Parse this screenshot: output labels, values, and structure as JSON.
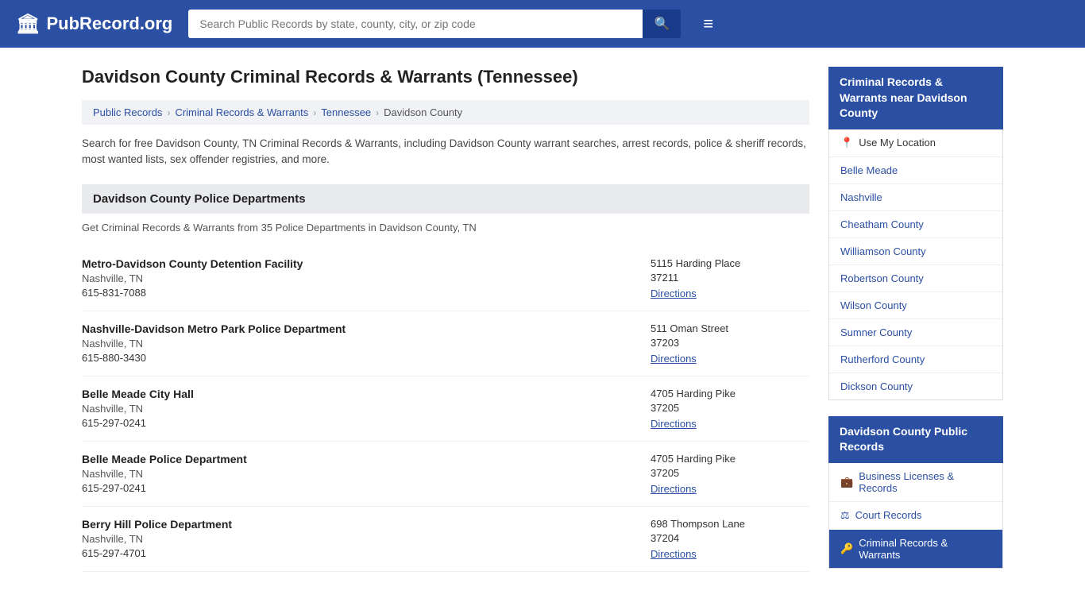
{
  "header": {
    "logo_text": "PubRecord.org",
    "logo_icon": "🏛",
    "search_placeholder": "Search Public Records by state, county, city, or zip code",
    "search_icon": "🔍",
    "menu_icon": "≡"
  },
  "page": {
    "title": "Davidson County Criminal Records & Warrants (Tennessee)",
    "breadcrumbs": [
      {
        "label": "Public Records",
        "href": "#"
      },
      {
        "label": "Criminal Records & Warrants",
        "href": "#"
      },
      {
        "label": "Tennessee",
        "href": "#"
      },
      {
        "label": "Davidson County",
        "href": "#"
      }
    ],
    "description": "Search for free Davidson County, TN Criminal Records & Warrants, including Davidson County warrant searches, arrest records, police & sheriff records, most wanted lists, sex offender registries, and more.",
    "section_title": "Davidson County Police Departments",
    "section_subtitle": "Get Criminal Records & Warrants from 35 Police Departments in Davidson County, TN",
    "entries": [
      {
        "name": "Metro-Davidson County Detention Facility",
        "city": "Nashville, TN",
        "phone": "615-831-7088",
        "address": "5115 Harding Place",
        "zip": "37211",
        "directions": "Directions"
      },
      {
        "name": "Nashville-Davidson Metro Park Police Department",
        "city": "Nashville, TN",
        "phone": "615-880-3430",
        "address": "511 Oman Street",
        "zip": "37203",
        "directions": "Directions"
      },
      {
        "name": "Belle Meade City Hall",
        "city": "Nashville, TN",
        "phone": "615-297-0241",
        "address": "4705 Harding Pike",
        "zip": "37205",
        "directions": "Directions"
      },
      {
        "name": "Belle Meade Police Department",
        "city": "Nashville, TN",
        "phone": "615-297-0241",
        "address": "4705 Harding Pike",
        "zip": "37205",
        "directions": "Directions"
      },
      {
        "name": "Berry Hill Police Department",
        "city": "Nashville, TN",
        "phone": "615-297-4701",
        "address": "698 Thompson Lane",
        "zip": "37204",
        "directions": "Directions"
      }
    ]
  },
  "sidebar": {
    "nearby_title": "Criminal Records & Warrants near Davidson County",
    "nearby_items": [
      {
        "label": "Use My Location",
        "icon": "📍",
        "type": "location"
      },
      {
        "label": "Belle Meade",
        "icon": ""
      },
      {
        "label": "Nashville",
        "icon": ""
      },
      {
        "label": "Cheatham County",
        "icon": ""
      },
      {
        "label": "Williamson County",
        "icon": ""
      },
      {
        "label": "Robertson County",
        "icon": ""
      },
      {
        "label": "Wilson County",
        "icon": ""
      },
      {
        "label": "Sumner County",
        "icon": ""
      },
      {
        "label": "Rutherford County",
        "icon": ""
      },
      {
        "label": "Dickson County",
        "icon": ""
      }
    ],
    "public_records_title": "Davidson County Public Records",
    "public_records_items": [
      {
        "label": "Business Licenses & Records",
        "icon": "💼",
        "active": false
      },
      {
        "label": "Court Records",
        "icon": "⚖",
        "active": false
      },
      {
        "label": "Criminal Records & Warrants",
        "icon": "🔑",
        "active": true
      }
    ]
  }
}
